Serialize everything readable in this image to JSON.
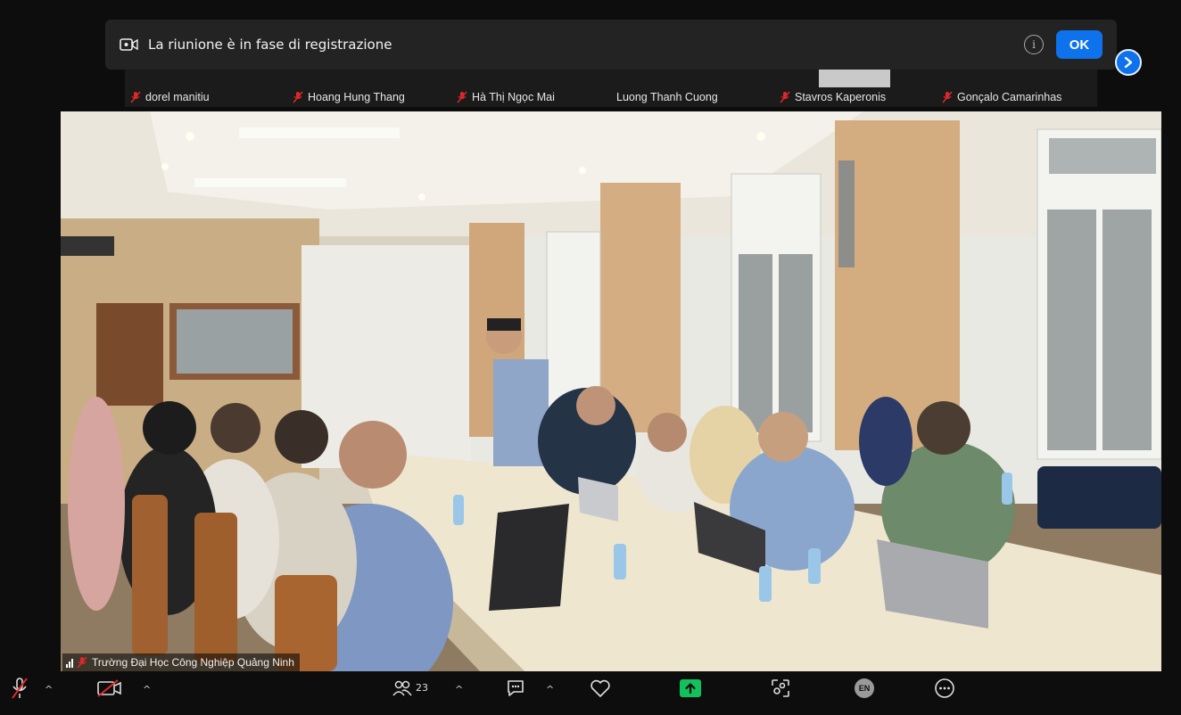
{
  "recording_banner": {
    "message": "La riunione è in fase di registrazione",
    "info_glyph": "i",
    "ok_label": "OK"
  },
  "participants": [
    {
      "name": "dorel manitiu",
      "muted": true
    },
    {
      "name": "Hoang Hung Thang",
      "muted": true
    },
    {
      "name": "Hà Thị Ngọc Mai",
      "muted": true
    },
    {
      "name": "Luong Thanh Cuong",
      "muted": false
    },
    {
      "name": "Stavros Kaperonis",
      "muted": true
    },
    {
      "name": "Gonçalo Camarinhas",
      "muted": true
    }
  ],
  "active_speaker": {
    "name": "Trường Đại Học Công Nghiệp Quảng Ninh",
    "muted": true
  },
  "toolbar": {
    "audio": {
      "icon": "mic-muted-icon"
    },
    "video": {
      "icon": "camera-off-icon"
    },
    "participants": {
      "icon": "participants-icon",
      "count": "23"
    },
    "chat": {
      "icon": "chat-icon"
    },
    "reactions": {
      "icon": "heart-icon"
    },
    "share": {
      "icon": "share-screen-icon"
    },
    "apps": {
      "icon": "apps-icon"
    },
    "language": {
      "icon": "language-icon",
      "badge": "EN"
    },
    "more": {
      "icon": "more-icon"
    }
  },
  "colors": {
    "accent": "#0e72ed",
    "share_green": "#12c15b",
    "muted_red": "#e02828"
  }
}
